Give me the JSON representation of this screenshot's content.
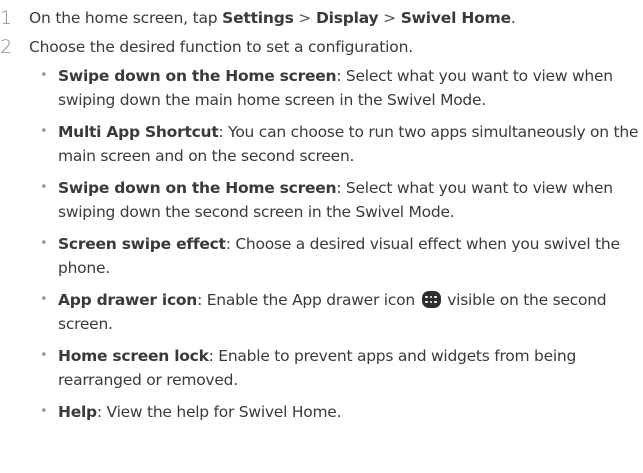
{
  "steps": [
    {
      "number": "1",
      "text_prefix": "On the home screen, tap ",
      "path": [
        "Settings",
        "Display",
        "Swivel Home"
      ],
      "path_separator": " > ",
      "text_suffix": "."
    },
    {
      "number": "2",
      "text": "Choose the desired function to set a configuration."
    }
  ],
  "bullets": [
    {
      "term": "Swipe down on the Home screen",
      "description": ": Select what you want to view when swiping down the main home screen in the Swivel Mode."
    },
    {
      "term": "Multi App Shortcut",
      "description": ": You can choose to run two apps simultaneously on the main screen and on the second screen."
    },
    {
      "term": "Swipe down on the Home screen",
      "description": ": Select what you want to view when swiping down the second screen in the Swivel Mode."
    },
    {
      "term": "Screen swipe effect",
      "description": ": Choose a desired visual effect when you swivel the phone."
    },
    {
      "term": "App drawer icon",
      "description_before_icon": ": Enable the App drawer icon ",
      "icon": "app-drawer-icon",
      "description_after_icon": " visible on the second screen."
    },
    {
      "term": "Home screen lock",
      "description": ": Enable to prevent apps and widgets from being rearranged or removed."
    },
    {
      "term": "Help",
      "description": ": View the help for Swivel Home."
    }
  ],
  "bullet_glyph": "•"
}
